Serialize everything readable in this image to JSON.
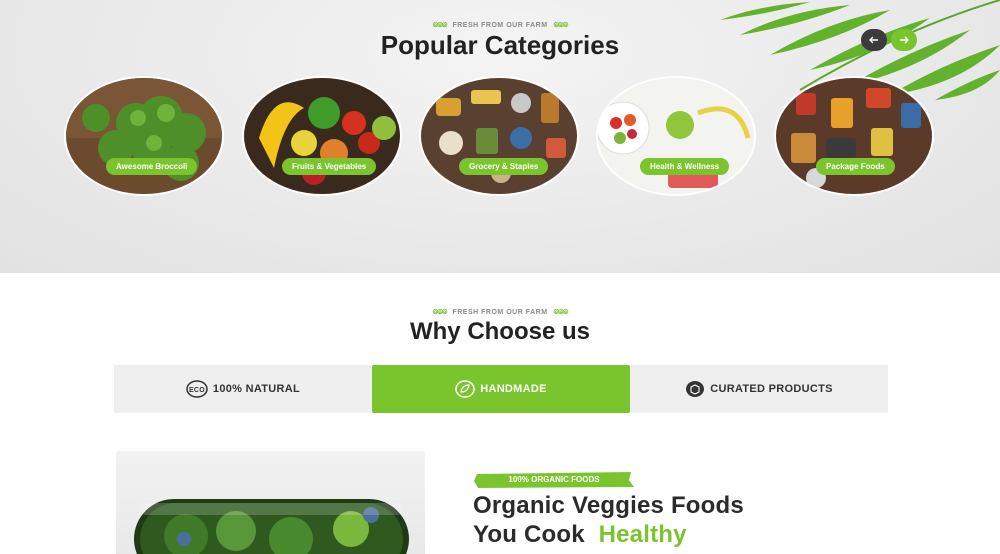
{
  "categories_section": {
    "eyebrow": "FRESH FROM OUR FARM",
    "title": "Popular Categories",
    "items": [
      {
        "label": "Awesome Broccoli",
        "icon": "broccoli-image"
      },
      {
        "label": "Fruits & Vegetables",
        "icon": "fruits-vegetables-image"
      },
      {
        "label": "Grocery & Staples",
        "icon": "grocery-staples-image"
      },
      {
        "label": "Health & Wellness",
        "icon": "health-wellness-image"
      },
      {
        "label": "Package Foods",
        "icon": "package-foods-image"
      }
    ],
    "prev_icon": "arrow-left-icon",
    "next_icon": "arrow-right-icon"
  },
  "why_section": {
    "eyebrow": "FRESH FROM OUR FARM",
    "title": "Why Choose us",
    "tabs": [
      {
        "label": "100% NATURAL",
        "icon": "eco-badge-icon",
        "active": false
      },
      {
        "label": "HANDMADE",
        "icon": "handmade-leaf-icon",
        "active": true
      },
      {
        "label": "CURATED PRODUCTS",
        "icon": "box-icon",
        "active": false
      }
    ]
  },
  "feature": {
    "badge": "100% ORGANIC FOODS",
    "headline_line1": "Organic Veggies Foods",
    "headline_line2_plain": "You Cook",
    "headline_line2_accent": "Healthy"
  },
  "colors": {
    "accent": "#7ac52e",
    "dark": "#222222",
    "tab_bg": "#efefef"
  }
}
